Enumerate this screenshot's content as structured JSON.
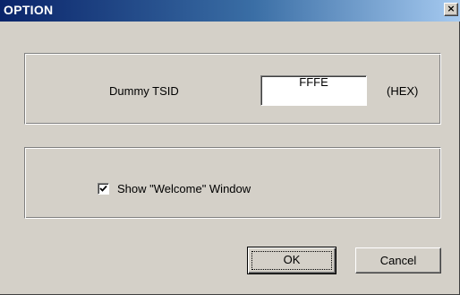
{
  "window": {
    "title": "OPTION",
    "close_glyph": "×"
  },
  "tsid_group": {
    "label": "Dummy TSID",
    "value": "FFFE",
    "unit": "(HEX)"
  },
  "welcome_group": {
    "checkbox_label": "Show \"Welcome\" Window",
    "checked": true
  },
  "buttons": {
    "ok": "OK",
    "cancel": "Cancel"
  },
  "colors": {
    "title_start": "#0a246a",
    "title_end": "#a6caf0",
    "face": "#d4d0c8"
  }
}
